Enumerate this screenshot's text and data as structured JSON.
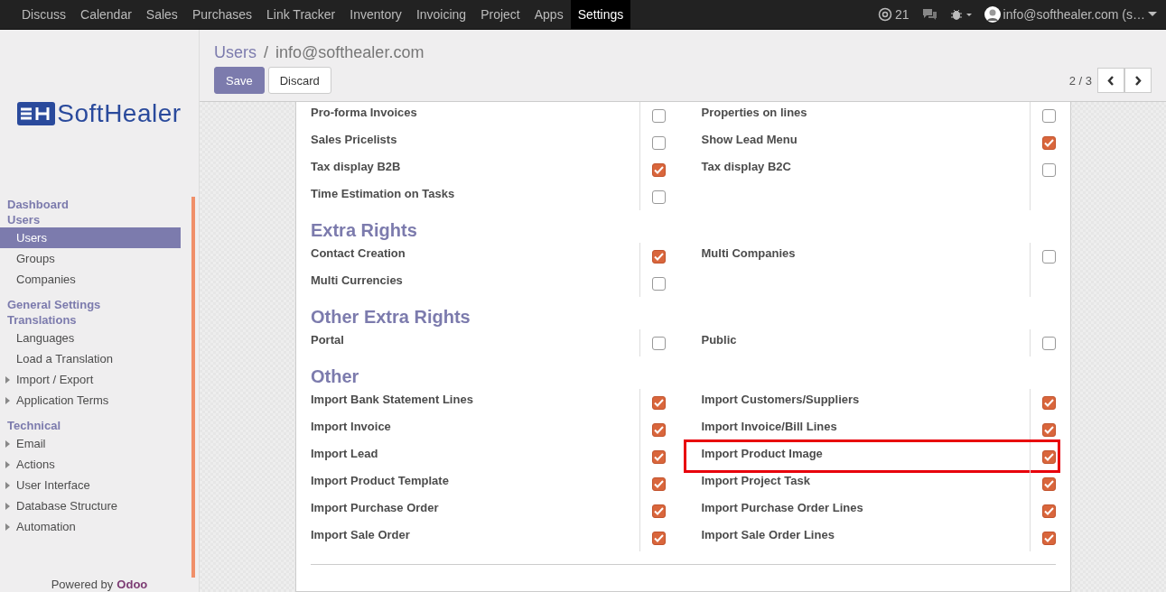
{
  "navbar": {
    "apps": [
      {
        "label": "Discuss",
        "selected": false
      },
      {
        "label": "Calendar",
        "selected": false
      },
      {
        "label": "Sales",
        "selected": false
      },
      {
        "label": "Purchases",
        "selected": false
      },
      {
        "label": "Link Tracker",
        "selected": false
      },
      {
        "label": "Inventory",
        "selected": false
      },
      {
        "label": "Invoicing",
        "selected": false
      },
      {
        "label": "Project",
        "selected": false
      },
      {
        "label": "Apps",
        "selected": false
      },
      {
        "label": "Settings",
        "selected": true
      }
    ],
    "mentions": "21",
    "user": "info@softhealer.com (s…"
  },
  "sidebar": {
    "logo": "SoftHealer",
    "menu": [
      {
        "kind": "header",
        "label": "Dashboard"
      },
      {
        "kind": "header",
        "label": "Users"
      },
      {
        "kind": "item",
        "label": "Users",
        "selected": true
      },
      {
        "kind": "item",
        "label": "Groups",
        "selected": false
      },
      {
        "kind": "item",
        "label": "Companies",
        "selected": false
      },
      {
        "kind": "header",
        "label": "General Settings"
      },
      {
        "kind": "header",
        "label": "Translations"
      },
      {
        "kind": "item",
        "label": "Languages",
        "selected": false
      },
      {
        "kind": "item",
        "label": "Load a Translation",
        "selected": false
      },
      {
        "kind": "folder",
        "label": "Import / Export",
        "selected": false
      },
      {
        "kind": "folder",
        "label": "Application Terms",
        "selected": false
      },
      {
        "kind": "header",
        "label": "Technical"
      },
      {
        "kind": "folder",
        "label": "Email",
        "selected": false
      },
      {
        "kind": "folder",
        "label": "Actions",
        "selected": false
      },
      {
        "kind": "folder",
        "label": "User Interface",
        "selected": false
      },
      {
        "kind": "folder",
        "label": "Database Structure",
        "selected": false
      },
      {
        "kind": "folder",
        "label": "Automation",
        "selected": false
      }
    ],
    "powered_by": "Powered by",
    "brand": "Odoo"
  },
  "control_panel": {
    "breadcrumb": "Users",
    "separator": "/",
    "record": "info@softhealer.com",
    "buttons": [
      {
        "label": "Save",
        "kind": "primary"
      },
      {
        "label": "Discard",
        "kind": "secondary"
      }
    ],
    "pager": "2 / 3"
  },
  "sections": [
    {
      "left": [
        {
          "label": "Pro-forma Invoices",
          "checked": false
        },
        {
          "label": "Sales Pricelists",
          "checked": false
        },
        {
          "label": "Tax display B2B",
          "checked": true
        },
        {
          "label": "Time Estimation on Tasks",
          "checked": false
        }
      ],
      "right": [
        {
          "label": "Properties on lines",
          "checked": false
        },
        {
          "label": "Show Lead Menu",
          "checked": true
        },
        {
          "label": "Tax display B2C",
          "checked": false
        }
      ]
    },
    {
      "title": "Extra Rights",
      "left": [
        {
          "label": "Contact Creation",
          "checked": true
        },
        {
          "label": "Multi Currencies",
          "checked": false
        }
      ],
      "right": [
        {
          "label": "Multi Companies",
          "checked": false
        }
      ]
    },
    {
      "title": "Other Extra Rights",
      "left": [
        {
          "label": "Portal",
          "checked": false
        }
      ],
      "right": [
        {
          "label": "Public",
          "checked": false
        }
      ]
    },
    {
      "title": "Other",
      "left": [
        {
          "label": "Import Bank Statement Lines",
          "checked": true
        },
        {
          "label": "Import Invoice",
          "checked": true
        },
        {
          "label": "Import Lead",
          "checked": true
        },
        {
          "label": "Import Product Template",
          "checked": true
        },
        {
          "label": "Import Purchase Order",
          "checked": true
        },
        {
          "label": "Import Sale Order",
          "checked": true
        }
      ],
      "right": [
        {
          "label": "Import Customers/Suppliers",
          "checked": true,
          "highlighted": false
        },
        {
          "label": "Import Invoice/Bill Lines",
          "checked": true,
          "highlighted": false
        },
        {
          "label": "Import Product Image",
          "checked": true,
          "highlighted": true
        },
        {
          "label": "Import Project Task",
          "checked": true,
          "highlighted": false
        },
        {
          "label": "Import Purchase Order Lines",
          "checked": true,
          "highlighted": false
        },
        {
          "label": "Import Sale Order Lines",
          "checked": true,
          "highlighted": false
        }
      ]
    }
  ]
}
